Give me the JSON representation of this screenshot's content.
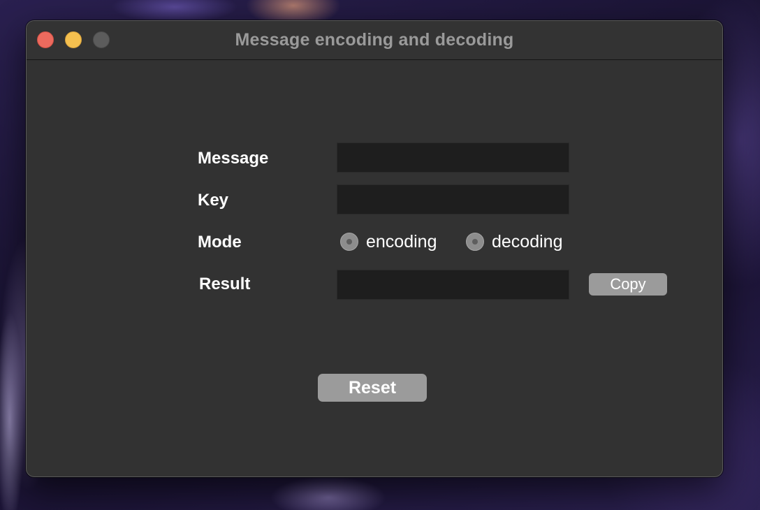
{
  "window": {
    "title": "Message encoding and decoding"
  },
  "form": {
    "message_label": "Message",
    "message_value": "",
    "key_label": "Key",
    "key_value": "",
    "mode_label": "Mode",
    "mode_options": [
      "encoding",
      "decoding"
    ],
    "result_label": "Result",
    "result_value": "",
    "copy_label": "Copy",
    "reset_label": "Reset"
  },
  "colors": {
    "window_bg": "#323232",
    "field_bg": "#1e1e1e",
    "button_bg": "#9b9b9b",
    "close": "#ec6a5e",
    "minimize": "#f4bf4f",
    "zoom_disabled": "#5c5c5c"
  }
}
